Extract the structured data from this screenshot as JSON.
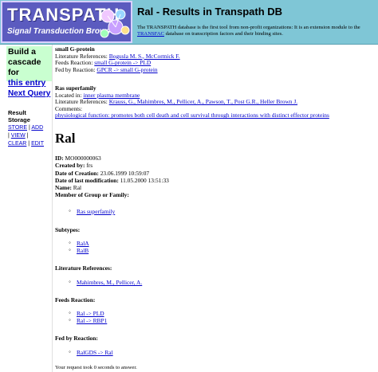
{
  "header": {
    "logo_title": "TRANSPATH",
    "logo_subtitle": "Signal Transduction Browser",
    "page_heading": "Ral - Results in Transpath DB",
    "description_line1": "The TRANSPATH database is the first tool from non-profit organizations: It is an extension module to the",
    "description_link": "TRANSFAC",
    "description_line2": "database on transcription factors and their binding sites."
  },
  "sidebar": {
    "cascade_line1": "Build a",
    "cascade_line2": "cascade for",
    "cascade_link": "this entry",
    "next_query": "Next Query",
    "result_storage_line1": "Result",
    "result_storage_line2": "Storage",
    "storage_store": "STORE",
    "storage_add": "ADD",
    "storage_view": "VIEW",
    "storage_clear": "CLEAR",
    "storage_edit": "EDIT"
  },
  "entry1": {
    "name": "small G-protein",
    "lit_label": "Literature References:",
    "lit_value": "Bogusla M. S., McCormick F.",
    "feeds_label": "Feeds Reaction:",
    "feeds_value": "small G-protein -> PLD",
    "fed_label": "Fed by Reaction:",
    "fed_value": "GPCR -> small G-protein"
  },
  "entry2": {
    "name": "Ras superfamily",
    "located_label": "Located in:",
    "located_value": "inner plasma membrane",
    "lit_label": "Literature References:",
    "lit_value": "Krauss, G., Mahimbres, M., Pellicer, A., Pawson, T., Post G.R., Heller Brown J.",
    "comments_label": "Comments:",
    "comments_value": "physiological function: promotes both cell death and cell survival through interactions with distinct effector proteins"
  },
  "record": {
    "title": "Ral",
    "id_label": "ID:",
    "id_value": "MO000000063",
    "created_label": "Created by:",
    "created_value": "frs",
    "date_created_label": "Date of Creation:",
    "date_created_value": "23.06.1999 10:59:07",
    "date_modified_label": "Date of last modification:",
    "date_modified_value": "11.05.2000 13:51:33",
    "name_label": "Name:",
    "name_value": "Ral",
    "member_label": "Member of Group or Family:",
    "member_items": [
      "Ras superfamily"
    ],
    "subtypes_label": "Subtypes:",
    "subtypes_items": [
      "RalA",
      "RalB"
    ],
    "literature_label": "Literature References:",
    "literature_items": [
      "Mahimbres, M., Pellicer, A."
    ],
    "feeds_label": "Feeds Reaction:",
    "feeds_items": [
      "Ral -> PLD",
      "Ral -> RBP1"
    ],
    "fed_label": "Fed by Reaction:",
    "fed_items": [
      "RalGDS -> Ral"
    ]
  },
  "footer_note": "Your request took 0 seconds to answer.",
  "colors": {
    "header_bg": "#7fc6d6",
    "logo_bg": "#5b5bbf",
    "cascade_bg": "#c9ffd0",
    "link": "#0000cc"
  }
}
